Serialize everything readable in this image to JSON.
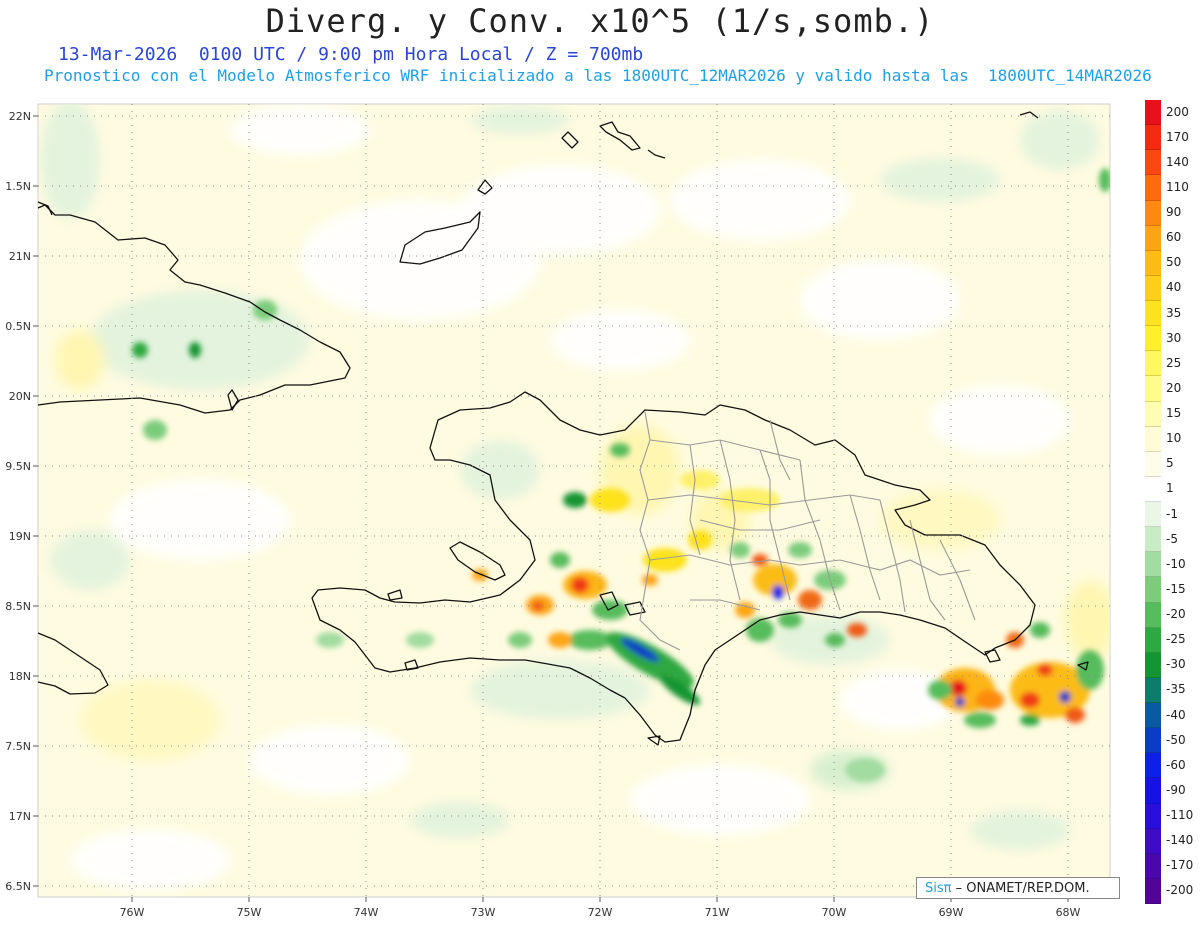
{
  "title": "Diverg. y Conv. x10^5 (1/s,somb.)",
  "subtitle1": "13-Mar-2026  0100 UTC / 9:00 pm Hora Local / Z = 700mb",
  "subtitle2": "Pronostico con el Modelo Atmosferico WRF inicializado a las 1800UTC_12MAR2026 y valido hasta las  1800UTC_14MAR2026",
  "credit": {
    "brand": "Sisπ",
    "rest": "– ONAMET/REP.DOM."
  },
  "lat_labels": [
    "22N",
    "1.5N",
    "21N",
    "0.5N",
    "20N",
    "9.5N",
    "19N",
    "8.5N",
    "18N",
    "7.5N",
    "17N",
    "6.5N"
  ],
  "lon_labels": [
    "76W",
    "75W",
    "74W",
    "73W",
    "72W",
    "71W",
    "70W",
    "69W",
    "68W"
  ],
  "colorbar": {
    "labels": [
      "200",
      "170",
      "140",
      "110",
      "90",
      "60",
      "50",
      "40",
      "35",
      "30",
      "25",
      "20",
      "15",
      "10",
      "5",
      "1",
      "-1",
      "-5",
      "-10",
      "-15",
      "-20",
      "-25",
      "-30",
      "-35",
      "-40",
      "-50",
      "-60",
      "-90",
      "-110",
      "-140",
      "-170",
      "-200"
    ],
    "colors": [
      "#e8101a",
      "#f52a12",
      "#fb4712",
      "#fd6a10",
      "#fd8a10",
      "#fca512",
      "#fcbc14",
      "#fdcf18",
      "#fde21e",
      "#fff02a",
      "#fff860",
      "#fffc8c",
      "#fffcb4",
      "#fffcd6",
      "#fffdea",
      "#ffffff",
      "#eaf6e6",
      "#c8ecc4",
      "#a2dca0",
      "#7ccc7c",
      "#56bc5c",
      "#2ea840",
      "#149432",
      "#0e7c6c",
      "#0a5aa2",
      "#0a3cc8",
      "#0c20e8",
      "#1612e6",
      "#2a0edc",
      "#3e0cc6",
      "#4a08aa",
      "#520496"
    ]
  },
  "colors": {
    "title": "#222222",
    "subtitle1": "#2b46d6",
    "subtitle2": "#1ea0e8",
    "coast": "#111111",
    "province": "#9a9a9a",
    "grid": "#8a8a8a"
  }
}
